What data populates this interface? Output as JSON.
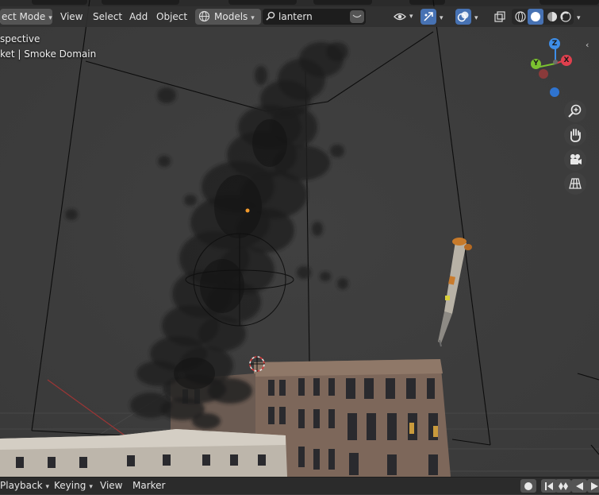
{
  "viewport_header": {
    "mode_label": "ect Mode",
    "menus": [
      "View",
      "Select",
      "Add",
      "Object"
    ],
    "collection_label": "Models",
    "search_value": "lantern"
  },
  "viewport_overlay": {
    "view_name": "spective",
    "object_info": "ket | Smoke Domain"
  },
  "gizmo": {
    "x_label": "X",
    "y_label": "Y",
    "z_label": "Z",
    "colors": {
      "x": "#e0404e",
      "y": "#7bc230",
      "z": "#3e8ee8"
    }
  },
  "nav_tools": [
    "zoom-icon",
    "hand-pan-icon",
    "camera-view-icon",
    "grid-ortho-icon"
  ],
  "timeline": {
    "playback_label": "Playback",
    "keying_label": "Keying",
    "view_label": "View",
    "marker_label": "Marker"
  },
  "colors": {
    "header_bg": "#303030",
    "button_bg": "#545454",
    "active_blue": "#4772b3",
    "viewport_bg": "#3d3d3d"
  }
}
